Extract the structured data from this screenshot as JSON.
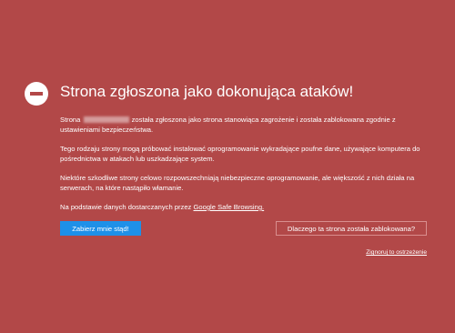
{
  "page": {
    "title": "Strona zgłoszona jako dokonująca ataków!",
    "background_color": "#b24848",
    "block_icon": "block-icon"
  },
  "content": {
    "paragraph1_prefix": "Strona",
    "paragraph1_suffix": "została zgłoszona jako strona stanowiąca zagrożenie i została zablokowana zgodnie z ustawieniami bezpieczeństwa.",
    "paragraph2": "Tego rodzaju strony mogą próbować instalować oprogramowanie wykradające poufne dane, używające komputera do pośrednictwa w atakach lub uszkadzające system.",
    "paragraph3": "Niektóre szkodliwe strony celowo rozpowszechniają niebezpieczne oprogramowanie, ale większość z nich działa na serwerach, na które nastąpiło włamanie.",
    "paragraph4_prefix": "Na podstawie danych dostarczanych przez",
    "paragraph4_link": "Google Safe Browsing."
  },
  "actions": {
    "primary_label": "Zabierz mnie stąd!",
    "primary_color": "#1e90e8",
    "secondary_label": "Dlaczego ta strona została zablokowana?",
    "ignore_label": "Zignoruj to ostrzeżenie"
  }
}
